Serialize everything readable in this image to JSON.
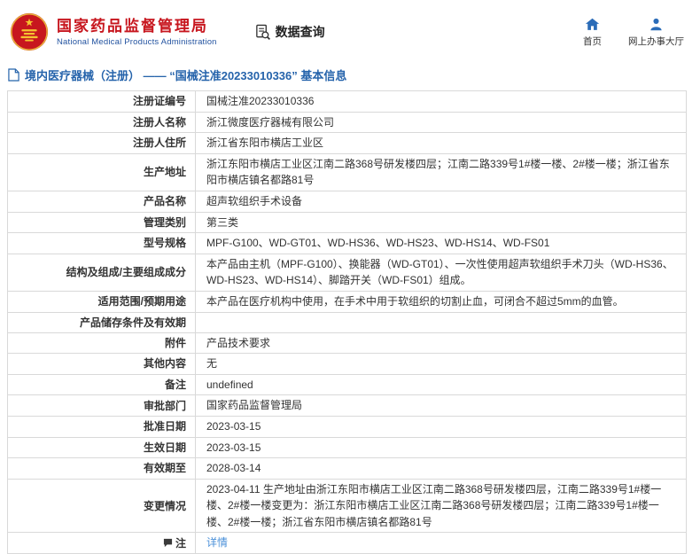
{
  "colors": {
    "brand_red": "#c7161e",
    "brand_blue": "#2353a0",
    "icon_blue": "#2b6cb8",
    "title_blue": "#2563ab",
    "link_blue": "#4a90d9",
    "table_border": "#d9d9d9"
  },
  "header": {
    "org_name_cn": "国家药品监督管理局",
    "org_name_en": "National Medical Products Administration",
    "nav_query": "数据查询",
    "nav_home": "首页",
    "nav_hall": "网上办事大厅"
  },
  "breadcrumb": {
    "text": "境内医疗器械（注册） —— “国械注准20233010336” 基本信息"
  },
  "table": {
    "rows": [
      {
        "label": "注册证编号",
        "value": "国械注准20233010336"
      },
      {
        "label": "注册人名称",
        "value": "浙江微度医疗器械有限公司"
      },
      {
        "label": "注册人住所",
        "value": "浙江省东阳市横店工业区"
      },
      {
        "label": "生产地址",
        "value": "浙江东阳市横店工业区江南二路368号研发楼四层；江南二路339号1#楼一楼、2#楼一楼；浙江省东阳市横店镇名都路81号"
      },
      {
        "label": "产品名称",
        "value": "超声软组织手术设备"
      },
      {
        "label": "管理类别",
        "value": "第三类"
      },
      {
        "label": "型号规格",
        "value": "MPF-G100、WD-GT01、WD-HS36、WD-HS23、WD-HS14、WD-FS01"
      },
      {
        "label": "结构及组成/主要组成成分",
        "value": "本产品由主机（MPF-G100）、换能器（WD-GT01）、一次性使用超声软组织手术刀头（WD-HS36、WD-HS23、WD-HS14）、脚踏开关（WD-FS01）组成。"
      },
      {
        "label": "适用范围/预期用途",
        "value": "本产品在医疗机构中使用，在手术中用于软组织的切割止血，可闭合不超过5mm的血管。"
      },
      {
        "label": "产品储存条件及有效期",
        "value": ""
      },
      {
        "label": "附件",
        "value": "产品技术要求"
      },
      {
        "label": "其他内容",
        "value": "无"
      },
      {
        "label": "备注",
        "value": "undefined"
      },
      {
        "label": "审批部门",
        "value": "国家药品监督管理局"
      },
      {
        "label": "批准日期",
        "value": "2023-03-15"
      },
      {
        "label": "生效日期",
        "value": "2023-03-15"
      },
      {
        "label": "有效期至",
        "value": "2028-03-14"
      },
      {
        "label": "变更情况",
        "value": "2023-04-11 生产地址由浙江东阳市横店工业区江南二路368号研发楼四层，江南二路339号1#楼一楼、2#楼一楼变更为：浙江东阳市横店工业区江南二路368号研发楼四层；江南二路339号1#楼一楼、2#楼一楼；浙江省东阳市横店镇名都路81号"
      },
      {
        "label": "注",
        "value": "详情",
        "link": true,
        "label_icon": "note-icon"
      }
    ]
  }
}
